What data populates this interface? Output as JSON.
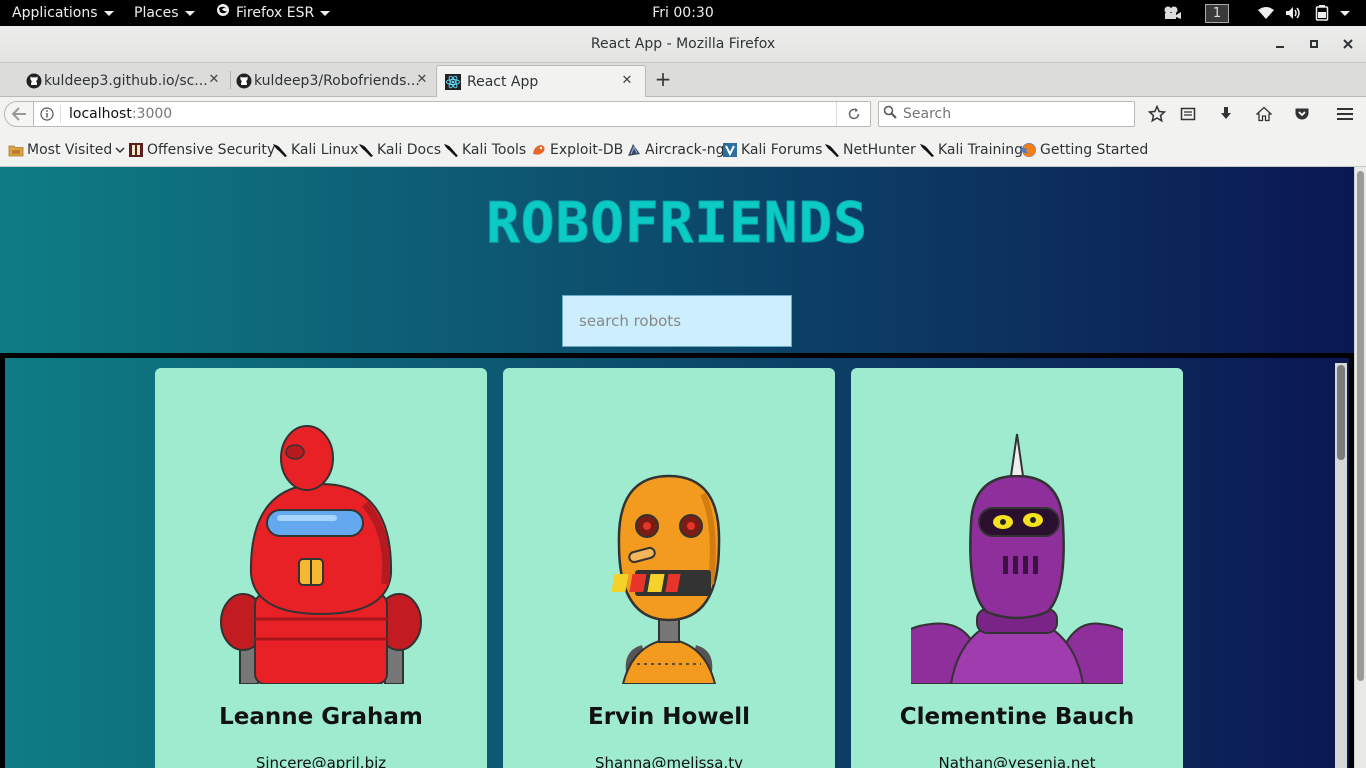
{
  "topbar": {
    "applications_label": "Applications",
    "places_label": "Places",
    "firefox_label": "Firefox ESR",
    "clock": "Fri 00:30",
    "workspace": "1"
  },
  "window": {
    "title": "React App - Mozilla Firefox"
  },
  "tabs": [
    {
      "label": "kuldeep3.github.io/sc...",
      "icon": "github-icon",
      "active": false
    },
    {
      "label": "kuldeep3/Robofriends...",
      "icon": "github-icon",
      "active": false
    },
    {
      "label": "React App",
      "icon": "react-icon",
      "active": true
    }
  ],
  "navbar": {
    "url_host": "localhost",
    "url_port": ":3000",
    "search_placeholder": "Search"
  },
  "bookmarks": [
    {
      "label": "Most Visited",
      "icon": "folder-icon"
    },
    {
      "label": "Offensive Security",
      "icon": "offsec-icon"
    },
    {
      "label": "Kali Linux",
      "icon": "kali-dragon-icon"
    },
    {
      "label": "Kali Docs",
      "icon": "kali-dragon-icon"
    },
    {
      "label": "Kali Tools",
      "icon": "kali-dragon-icon"
    },
    {
      "label": "Exploit-DB",
      "icon": "exploit-db-icon"
    },
    {
      "label": "Aircrack-ng",
      "icon": "aircrack-icon"
    },
    {
      "label": "Kali Forums",
      "icon": "kali-forums-icon"
    },
    {
      "label": "NetHunter",
      "icon": "kali-dragon-icon"
    },
    {
      "label": "Kali Training",
      "icon": "kali-dragon-icon"
    },
    {
      "label": "Getting Started",
      "icon": "firefox-icon"
    }
  ],
  "page": {
    "title": "ROBOFRIENDS",
    "search_placeholder": "search robots",
    "robots": [
      {
        "name": "Leanne Graham",
        "email": "Sincere@april.biz",
        "color": "#e82127"
      },
      {
        "name": "Ervin Howell",
        "email": "Shanna@melissa.tv",
        "color": "#f39b1f"
      },
      {
        "name": "Clementine Bauch",
        "email": "Nathan@yesenia.net",
        "color": "#8e2f9b"
      }
    ]
  },
  "colors": {
    "card_bg": "#9eebcf",
    "title_color": "#0ccac4",
    "gradient_left": "#0e7d84",
    "gradient_right": "#0b1752"
  }
}
